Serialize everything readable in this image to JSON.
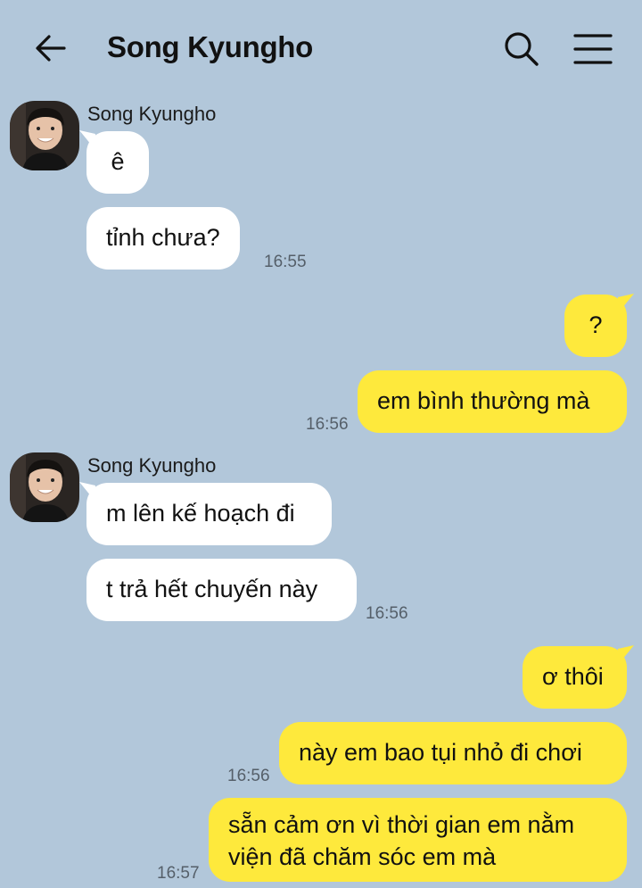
{
  "header": {
    "title": "Song Kyungho",
    "back_icon": "arrow-left-icon",
    "search_icon": "search-icon",
    "menu_icon": "hamburger-menu-icon"
  },
  "colors": {
    "background": "#b2c7da",
    "incoming_bubble": "#ffffff",
    "outgoing_bubble": "#fee93c",
    "time_text": "#555f69"
  },
  "messages": [
    {
      "direction": "in",
      "sender": "Song Kyungho",
      "text": "ê"
    },
    {
      "direction": "in",
      "text": "tỉnh chưa?",
      "time": "16:55"
    },
    {
      "direction": "out",
      "text": "?"
    },
    {
      "direction": "out",
      "text": "em bình thường mà",
      "time": "16:56"
    },
    {
      "direction": "in",
      "sender": "Song Kyungho",
      "text": "m lên kế hoạch đi"
    },
    {
      "direction": "in",
      "text": "t trả hết chuyến này",
      "time": "16:56"
    },
    {
      "direction": "out",
      "text": "ơ thôi"
    },
    {
      "direction": "out",
      "text": "này em bao tụi nhỏ đi chơi",
      "time": "16:56"
    },
    {
      "direction": "out",
      "text_line1": "sẵn cảm ơn vì thời gian em nằm",
      "text_line2": "viện đã chăm sóc em mà",
      "time": "16:57"
    }
  ]
}
